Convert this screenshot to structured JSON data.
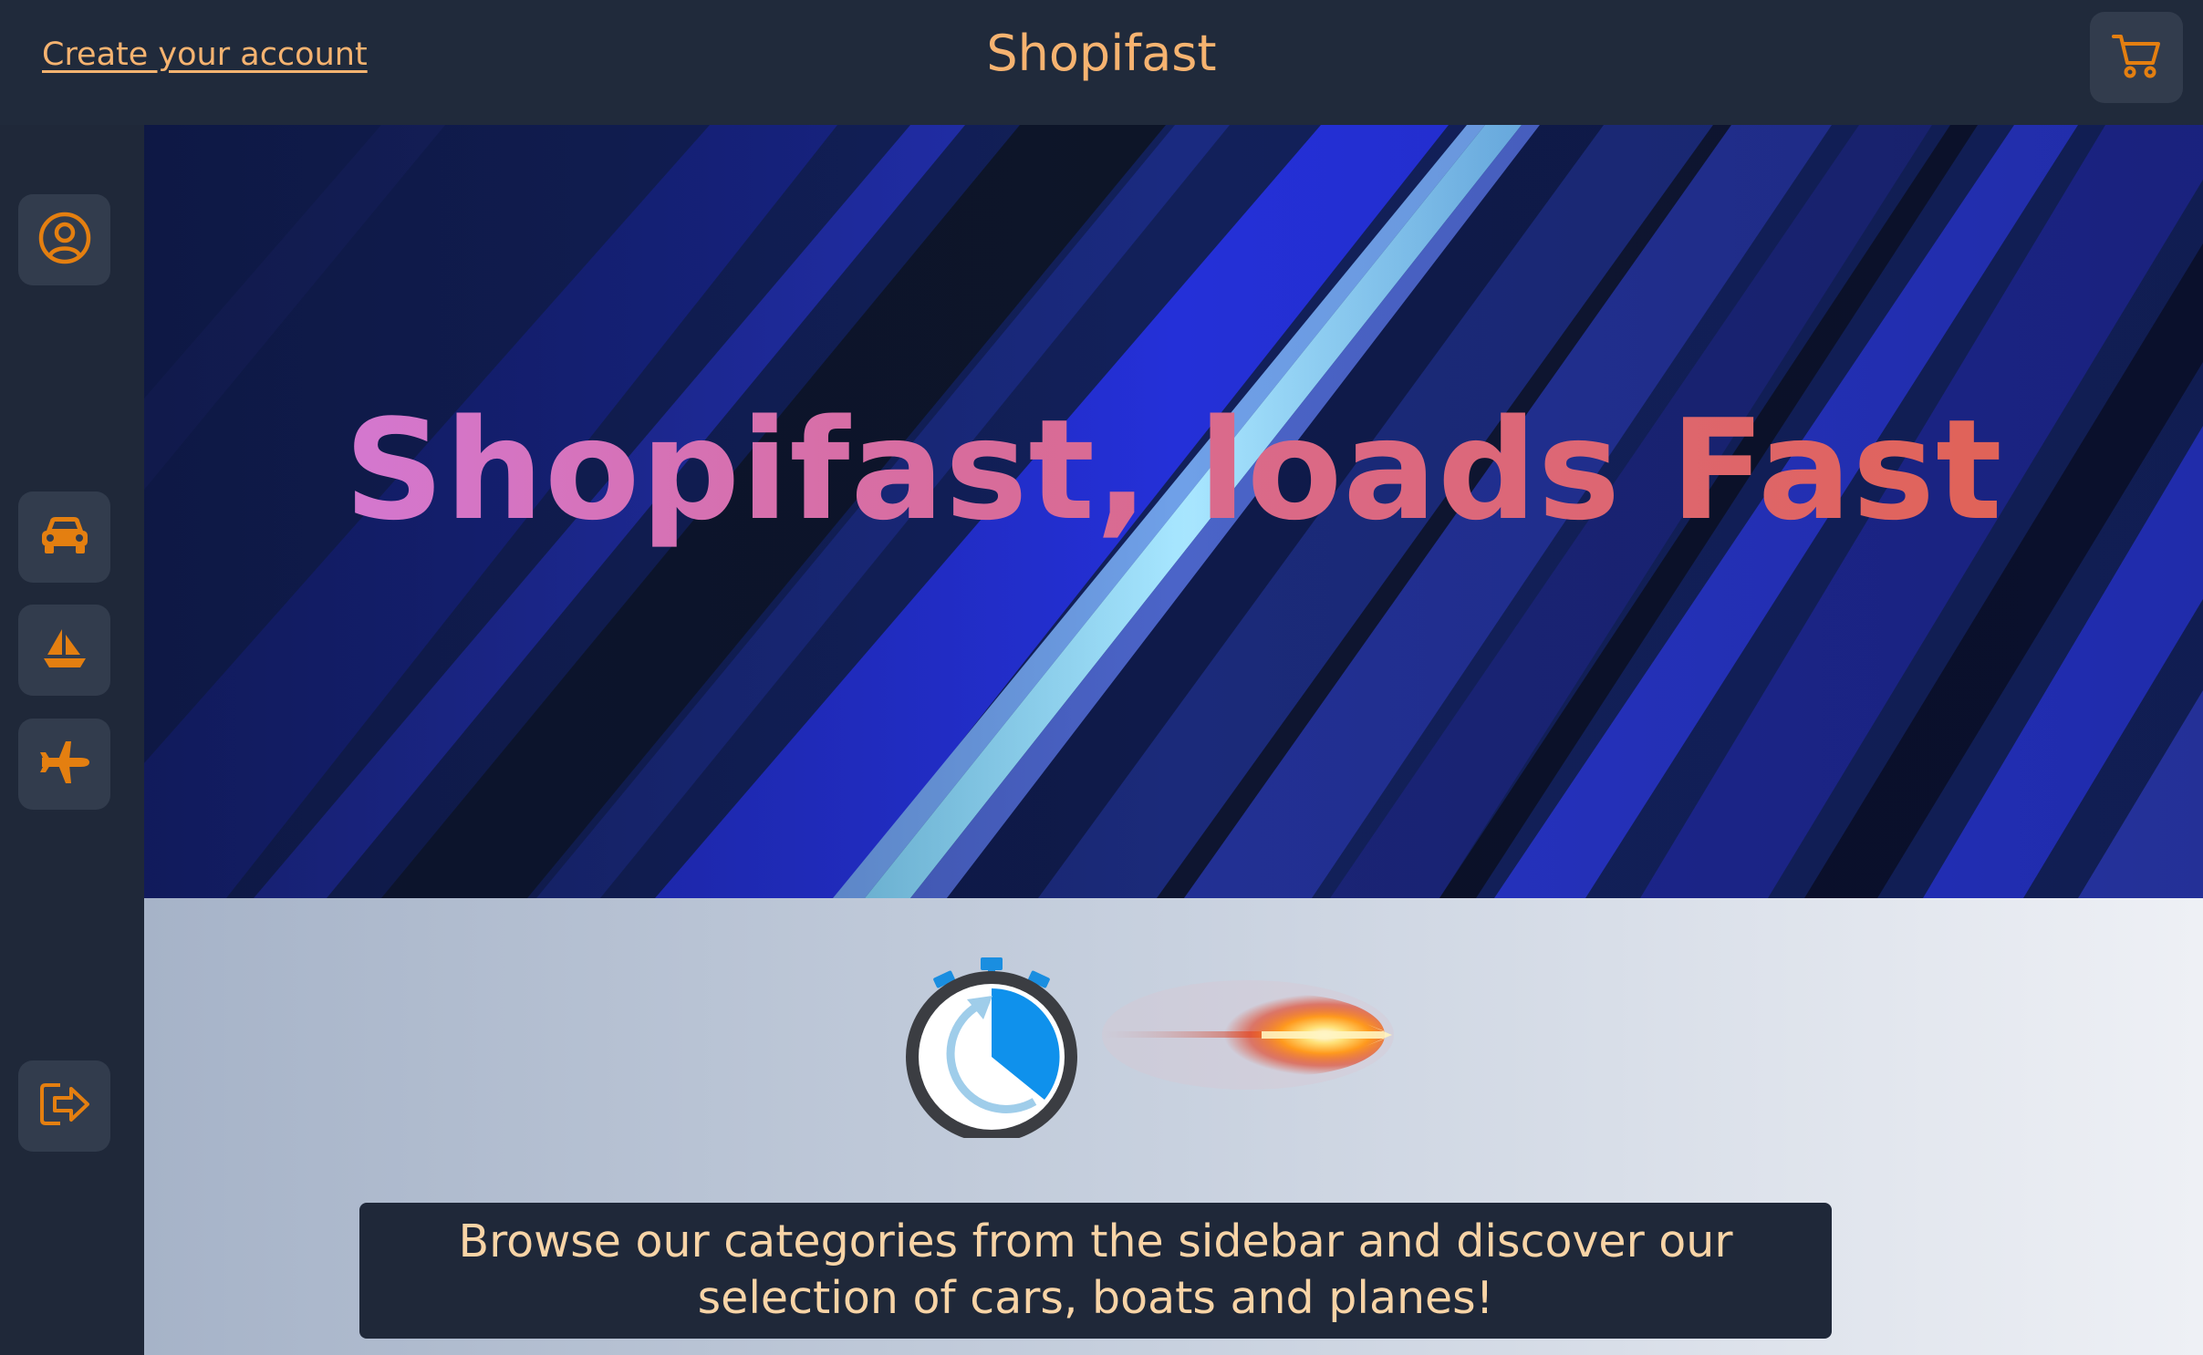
{
  "header": {
    "create_account_label": "Create your account",
    "brand": "Shopifast",
    "cart_icon": "cart-icon"
  },
  "sidebar": {
    "items": [
      {
        "name": "account",
        "icon": "user-circle-icon"
      },
      {
        "name": "cars",
        "icon": "car-icon"
      },
      {
        "name": "boats",
        "icon": "sailboat-icon"
      },
      {
        "name": "planes",
        "icon": "plane-icon"
      },
      {
        "name": "logout",
        "icon": "logout-icon"
      }
    ]
  },
  "hero": {
    "title": "Shopifast, loads Fast"
  },
  "lower": {
    "icons": [
      "stopwatch-icon",
      "fireball-icon"
    ],
    "message": "Browse our categories from the sidebar and discover our selection of cars, boats and planes!"
  },
  "colors": {
    "accent": "#f6b370",
    "icon_orange": "#e47f10",
    "panel": "#1f2839",
    "button_bg": "#323c4d"
  }
}
